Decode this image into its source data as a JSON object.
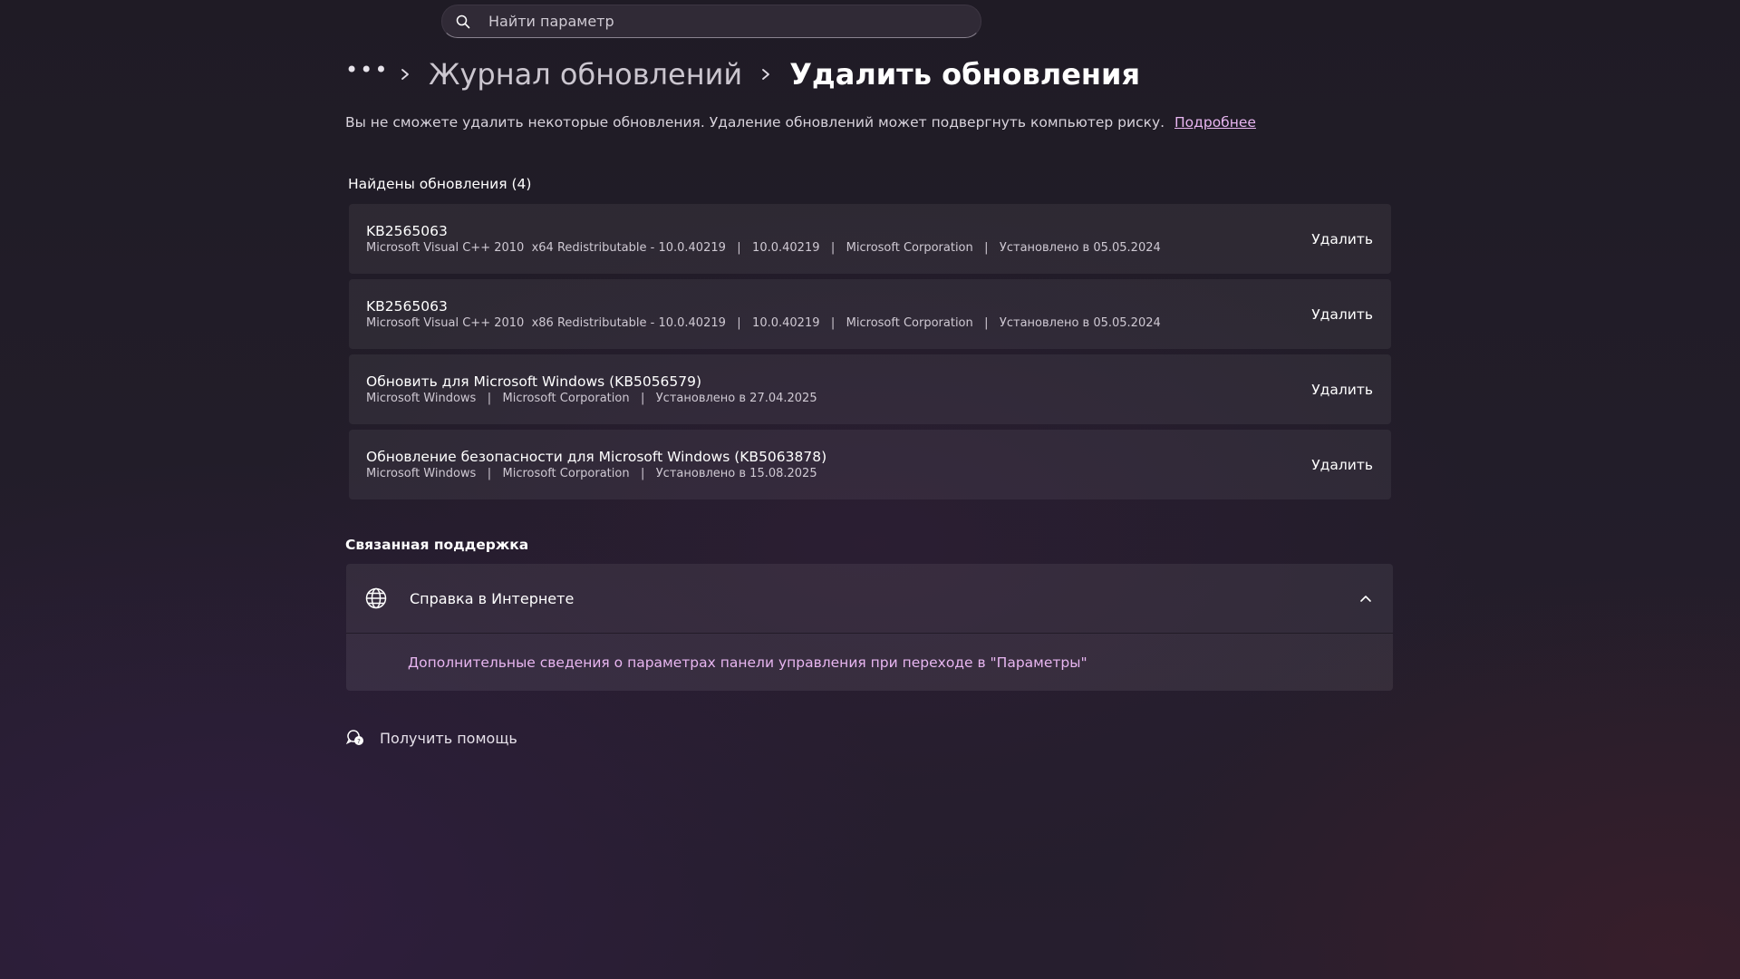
{
  "search": {
    "placeholder": "Найти параметр"
  },
  "breadcrumb": {
    "more": "•••",
    "previous": "Журнал обновлений",
    "current": "Удалить обновления"
  },
  "description": {
    "text": "Вы не сможете удалить некоторые обновления. Удаление обновлений может подвергнуть компьютер риску.",
    "link": "Подробнее"
  },
  "updates": {
    "header": "Найдены обновления (4)",
    "items": [
      {
        "title": "KB2565063",
        "details": "Microsoft Visual C++ 2010  x64 Redistributable - 10.0.40219   |   10.0.40219   |   Microsoft Corporation   |   Установлено в 05.05.2024",
        "action": "Удалить"
      },
      {
        "title": "KB2565063",
        "details": "Microsoft Visual C++ 2010  x86 Redistributable - 10.0.40219   |   10.0.40219   |   Microsoft Corporation   |   Установлено в 05.05.2024",
        "action": "Удалить"
      },
      {
        "title": "Обновить для Microsoft Windows (KB5056579)",
        "details": "Microsoft Windows   |   Microsoft Corporation   |   Установлено в 27.04.2025",
        "action": "Удалить"
      },
      {
        "title": "Обновление безопасности для Microsoft Windows (KB5063878)",
        "details": "Microsoft Windows   |   Microsoft Corporation   |   Установлено в 15.08.2025",
        "action": "Удалить"
      }
    ]
  },
  "support": {
    "title": "Связанная поддержка",
    "header": "Справка в Интернете",
    "link": "Дополнительные сведения о параметрах панели управления при переходе в \"Параметры\""
  },
  "help": {
    "label": "Получить помощь"
  },
  "colors": {
    "accent_link": "#e8b6f1",
    "card_bg": "rgba(255,255,255,0.06)"
  }
}
